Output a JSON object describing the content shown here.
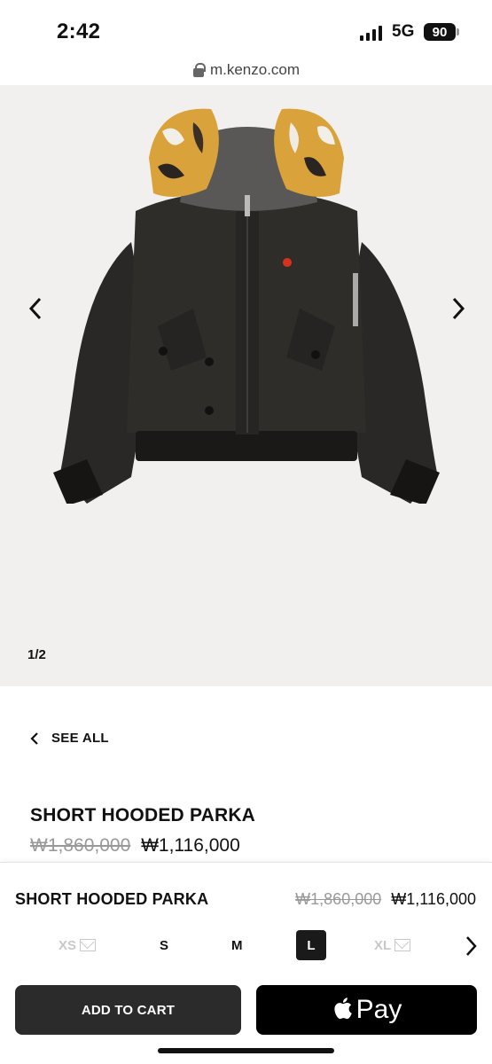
{
  "status_bar": {
    "time": "2:42",
    "network": "5G",
    "battery": "90"
  },
  "browser": {
    "url": "m.kenzo.com"
  },
  "gallery": {
    "counter": "1/2",
    "background": "#f2f0ee"
  },
  "nav": {
    "see_all": "SEE ALL"
  },
  "product": {
    "title": "SHORT HOODED PARKA",
    "price_original": "₩1,860,000",
    "price_sale": "₩1,116,000"
  },
  "sticky": {
    "title": "SHORT HOODED PARKA",
    "price_original": "₩1,860,000",
    "price_sale": "₩1,116,000",
    "sizes": [
      {
        "label": "XS",
        "state": "unavailable"
      },
      {
        "label": "S",
        "state": "available"
      },
      {
        "label": "M",
        "state": "available"
      },
      {
        "label": "L",
        "state": "selected"
      },
      {
        "label": "XL",
        "state": "unavailable"
      }
    ],
    "add_to_cart": "ADD TO CART",
    "apple_pay": "Pay"
  }
}
